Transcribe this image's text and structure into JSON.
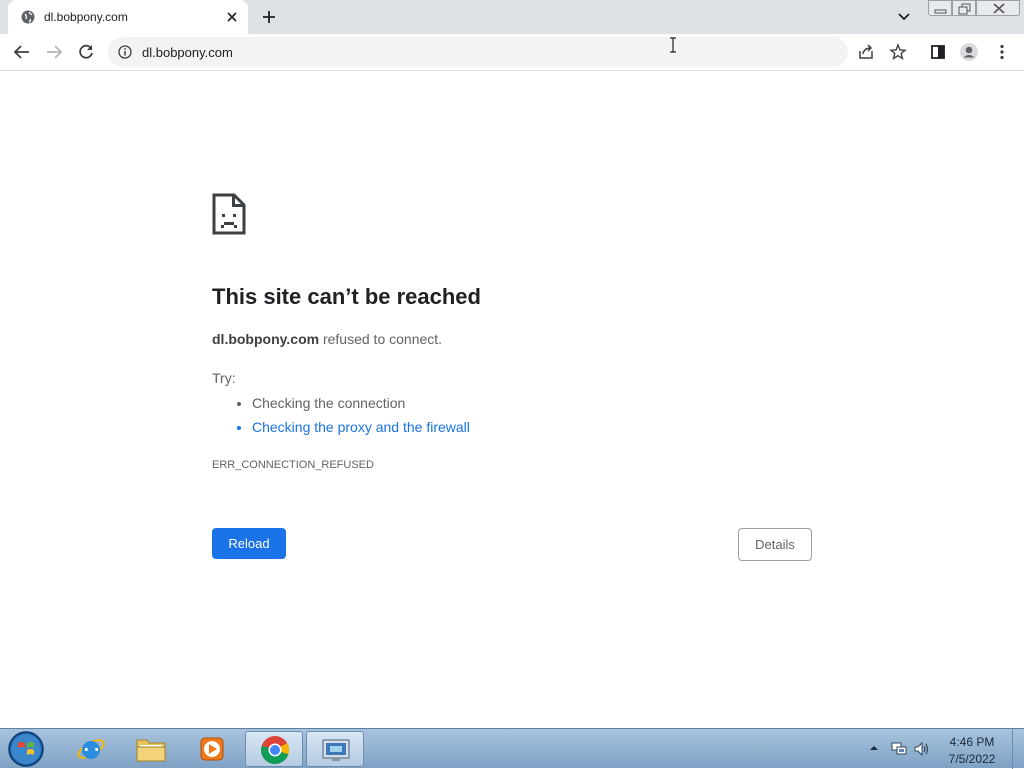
{
  "browser": {
    "tab": {
      "title": "dl.bobpony.com",
      "favicon": "globe-icon"
    },
    "url": "dl.bobpony.com"
  },
  "error_page": {
    "title": "This site can’t be reached",
    "host": "dl.bobpony.com",
    "message_suffix": " refused to connect.",
    "try_label": "Try:",
    "suggestions": [
      "Checking the connection",
      "Checking the proxy and the firewall"
    ],
    "error_code": "ERR_CONNECTION_REFUSED",
    "reload_label": "Reload",
    "details_label": "Details"
  },
  "taskbar": {
    "apps": [
      "internet-explorer",
      "file-explorer",
      "media-player",
      "chrome",
      "remote-desktop"
    ],
    "clock": {
      "time": "4:46 PM",
      "date": "7/5/2022"
    }
  },
  "colors": {
    "accent": "#1a73e8",
    "tabstrip": "#dee1e6"
  }
}
